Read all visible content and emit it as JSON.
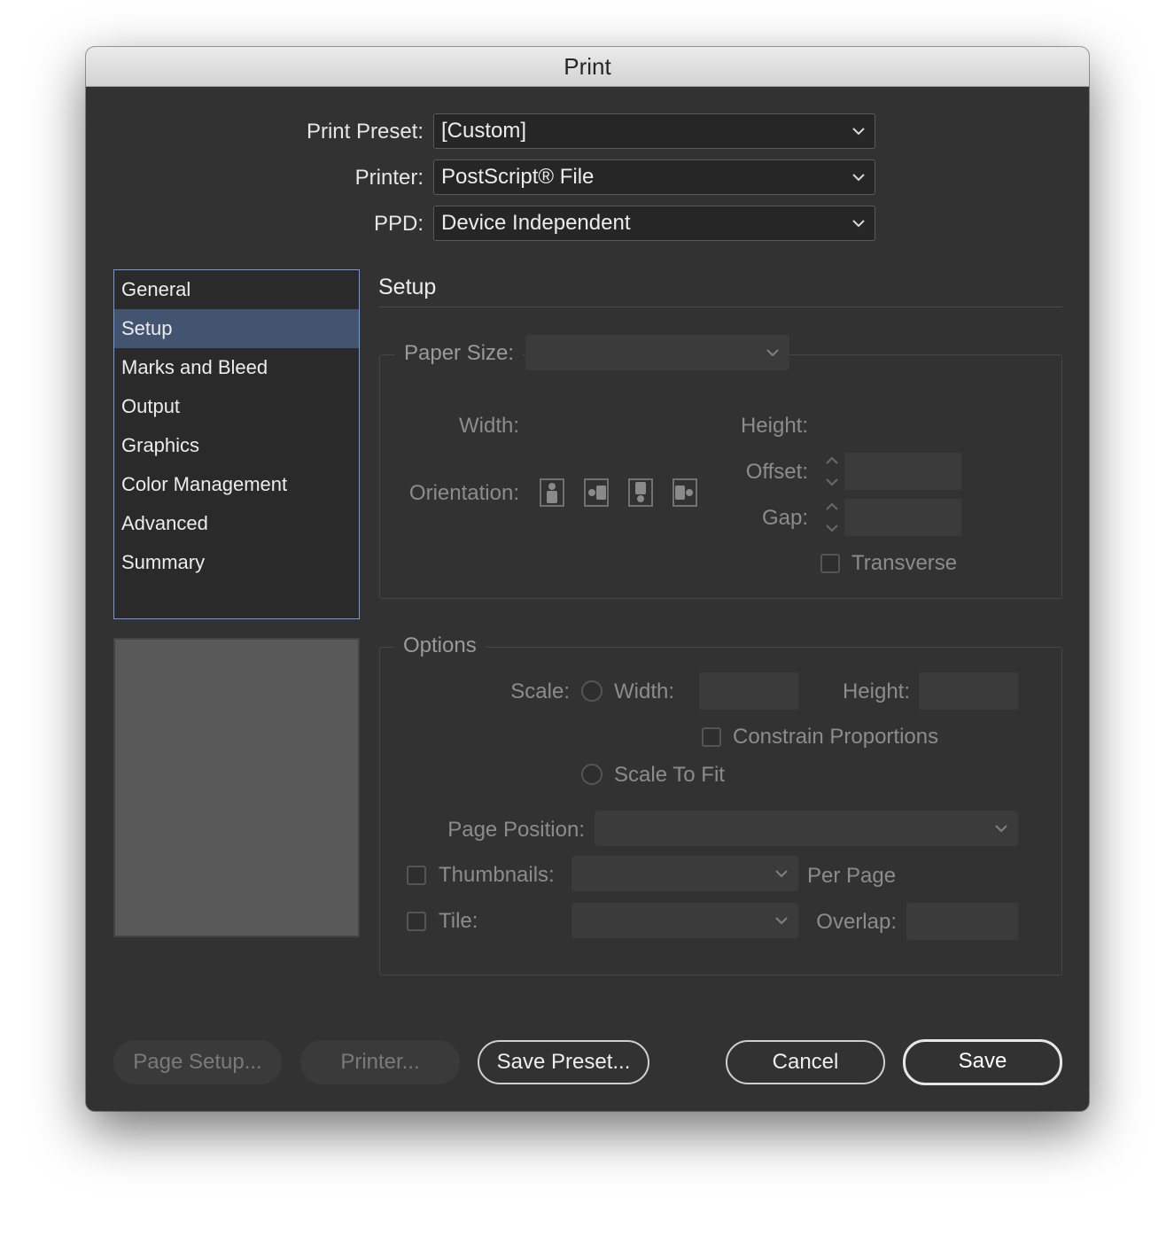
{
  "window": {
    "title": "Print"
  },
  "top_fields": {
    "print_preset": {
      "label": "Print Preset:",
      "value": "[Custom]"
    },
    "printer": {
      "label": "Printer:",
      "value": "PostScript® File"
    },
    "ppd": {
      "label": "PPD:",
      "value": "Device Independent"
    }
  },
  "sidebar": {
    "items": [
      {
        "label": "General"
      },
      {
        "label": "Setup",
        "selected": true
      },
      {
        "label": "Marks and Bleed"
      },
      {
        "label": "Output"
      },
      {
        "label": "Graphics"
      },
      {
        "label": "Color Management"
      },
      {
        "label": "Advanced"
      },
      {
        "label": "Summary"
      }
    ]
  },
  "setup": {
    "title": "Setup",
    "paper_size": {
      "label": "Paper Size:",
      "value": ""
    },
    "width_label": "Width:",
    "height_label": "Height:",
    "orientation_label": "Orientation:",
    "offset": {
      "label": "Offset:",
      "value": ""
    },
    "gap": {
      "label": "Gap:",
      "value": ""
    },
    "transverse_label": "Transverse"
  },
  "options": {
    "title": "Options",
    "scale_label": "Scale:",
    "width_label": "Width:",
    "height_label": "Height:",
    "constrain_label": "Constrain Proportions",
    "scale_to_fit_label": "Scale To Fit",
    "page_position": {
      "label": "Page Position:",
      "value": ""
    },
    "thumbnails": {
      "label": "Thumbnails:",
      "suffix": "Per Page",
      "value": ""
    },
    "tile": {
      "label": "Tile:",
      "value": ""
    },
    "overlap_label": "Overlap:"
  },
  "buttons": {
    "page_setup": "Page Setup...",
    "printer": "Printer...",
    "save_preset": "Save Preset...",
    "cancel": "Cancel",
    "save": "Save"
  },
  "colors": {
    "window_bg": "#323232",
    "selection": "#435470",
    "list_border": "#6f9ae0"
  }
}
